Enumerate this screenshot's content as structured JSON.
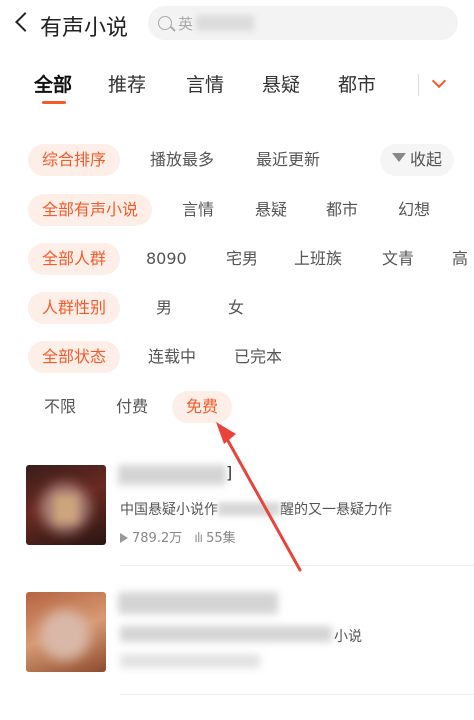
{
  "header": {
    "title": "有声小说",
    "search_placeholder": "英"
  },
  "tabs": [
    {
      "label": "全部",
      "active": true
    },
    {
      "label": "推荐",
      "active": false
    },
    {
      "label": "言情",
      "active": false
    },
    {
      "label": "悬疑",
      "active": false
    },
    {
      "label": "都市",
      "active": false
    }
  ],
  "filters": {
    "sort": {
      "selected": "综合排序",
      "options": [
        "播放最多",
        "最近更新"
      ],
      "collapse_label": "收起"
    },
    "genre": {
      "selected": "全部有声小说",
      "options": [
        "言情",
        "悬疑",
        "都市",
        "幻想"
      ]
    },
    "audience": {
      "selected": "全部人群",
      "options": [
        "8090",
        "宅男",
        "上班族",
        "文青",
        "高"
      ]
    },
    "gender": {
      "selected": "人群性别",
      "options": [
        "男",
        "女"
      ]
    },
    "status": {
      "selected": "全部状态",
      "options": [
        "连载中",
        "已完本"
      ]
    },
    "price": {
      "options": [
        "不限",
        "付费"
      ],
      "selected": "免费"
    }
  },
  "books": [
    {
      "title_suffix": "]",
      "desc_prefix": "中国悬疑小说作",
      "desc_suffix": "醒的又一悬疑力作",
      "plays": "789.2万",
      "episodes": "55集"
    },
    {
      "desc_suffix": "小说"
    }
  ],
  "colors": {
    "accent": "#f25c2c",
    "chip_bg": "#fdeee8",
    "annotation_arrow": "#e8443a"
  }
}
